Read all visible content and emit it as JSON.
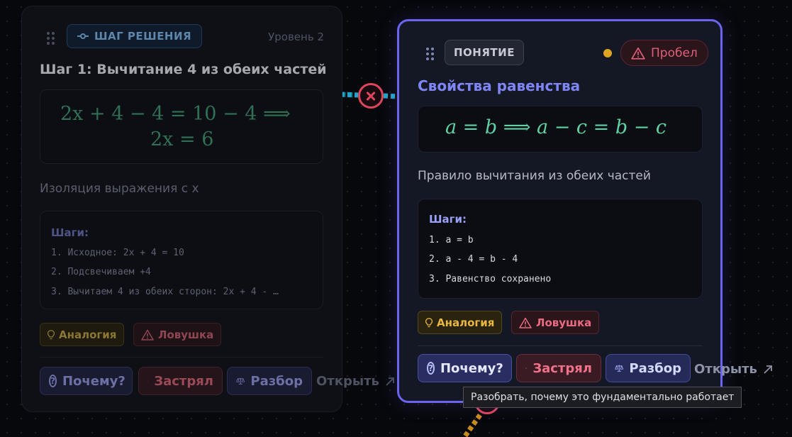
{
  "left_card": {
    "badge": "ШАГ РЕШЕНИЯ",
    "level": "Уровень 2",
    "title": "Шаг 1: Вычитание 4 из обеих частей",
    "math_line1": "2x + 4 − 4 = 10 − 4 ⟹",
    "math_line2": "2x = 6",
    "description": "Изоляция выражения с x",
    "steps_title": "Шаги:",
    "steps": [
      "1. Исходное: 2x + 4 = 10",
      "2. Подсвечиваем +4",
      "3. Вычитаем 4 из обеих сторон: 2x + 4 - …"
    ],
    "chip_analogy": "Аналогия",
    "chip_trap": "Ловушка",
    "btn_why": "Почему?",
    "btn_stuck": "Застрял",
    "btn_parse": "Разбор",
    "open": "Открыть"
  },
  "right_card": {
    "badge": "ПОНЯТИЕ",
    "gap_badge": "Пробел",
    "title": "Свойства равенства",
    "math_line": "a = b  ⟹  a − c = b − c",
    "description": "Правило вычитания из обеих частей",
    "steps_title": "Шаги:",
    "steps": [
      "1. a = b",
      "2. a - 4 = b - 4",
      "3. Равенство сохранено"
    ],
    "chip_analogy": "Аналогия",
    "chip_trap": "Ловушка",
    "btn_why": "Почему?",
    "btn_stuck": "Застрял",
    "btn_parse": "Разбор",
    "open": "Открыть"
  },
  "tooltip": "Разобрать, почему это фундаментально работает",
  "colors": {
    "accent": "#6a64f0",
    "edge_teal": "#1ea7c9",
    "edge_orange": "#c98a1e",
    "error_red": "#e0455e",
    "warning_yellow": "#e0a520"
  }
}
